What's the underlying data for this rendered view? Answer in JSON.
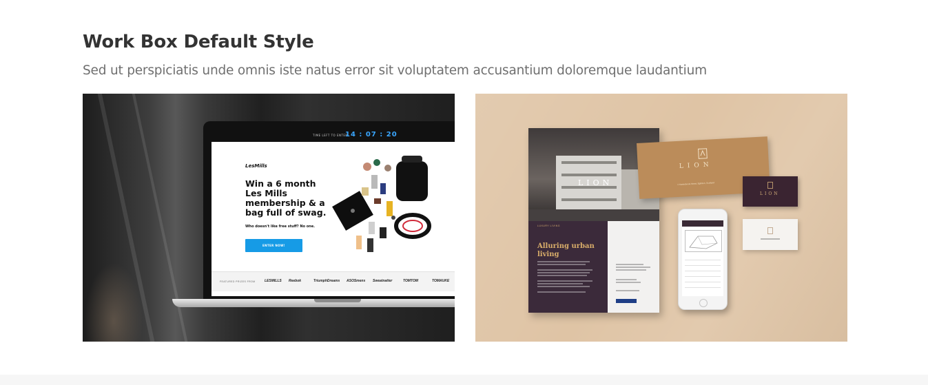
{
  "section": {
    "title": "Work Box Default Style",
    "subtitle": "Sed ut perspiciatis unde omnis iste natus error sit voluptatem accusantium doloremque laudantium"
  },
  "work_boxes": [
    {
      "image": "laptop-mockup",
      "screen": {
        "timer_label": "TIME LEFT TO ENTER",
        "timer_value": "14 : 07 : 20",
        "logo": "LesMills",
        "headline": "Win a 6 month Les Mills membership & a bag full of swag.",
        "subline": "Who doesn't like free stuff? No one.",
        "cta": "ENTER NOW!",
        "featured_label": "FEATURED PRIZES FROM",
        "brands": [
          "LESMILLS",
          "Reebok",
          "TriumphDreams",
          "ASOSmens",
          "Sweatnatter",
          "TOMTOM",
          "TOMAUKE"
        ]
      }
    },
    {
      "image": "stationery-mockup",
      "brochure": {
        "mark": "LION",
        "tag": "LUXURY LIVING",
        "title": "Alluring urban living"
      },
      "envelope": {
        "mark": "LION",
        "address": "1 Hunterbrook Street, Eglinton, Scotland"
      },
      "card": {
        "mark": "LION"
      }
    }
  ],
  "colors": {
    "heading": "#333333",
    "subtitle": "#6f6f6f",
    "cta_blue": "#169be6",
    "tan_background": "#dfc4a5",
    "plum": "#3a2431",
    "gold": "#d9ae6a"
  }
}
